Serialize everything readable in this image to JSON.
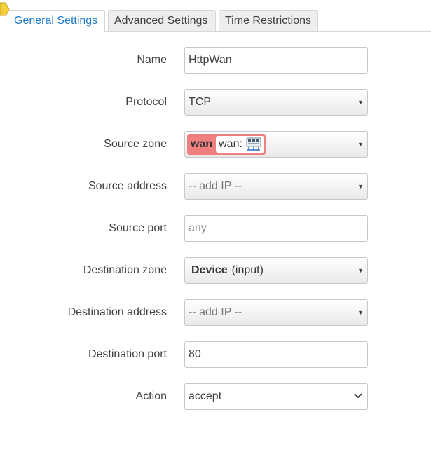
{
  "tabs": [
    {
      "label": "General Settings",
      "active": true
    },
    {
      "label": "Advanced Settings",
      "active": false
    },
    {
      "label": "Time Restrictions",
      "active": false
    }
  ],
  "form": {
    "name": {
      "label": "Name",
      "value": "HttpWan"
    },
    "protocol": {
      "label": "Protocol",
      "value": "TCP"
    },
    "source_zone": {
      "label": "Source zone",
      "zone": "wan",
      "network": "wan:",
      "icon": "network-ports-icon",
      "zone_color": "#f08080"
    },
    "source_address": {
      "label": "Source address",
      "placeholder": "-- add IP --"
    },
    "source_port": {
      "label": "Source port",
      "placeholder": "any"
    },
    "destination_zone": {
      "label": "Destination zone",
      "device": "Device",
      "detail": "(input)"
    },
    "destination_address": {
      "label": "Destination address",
      "placeholder": "-- add IP --"
    },
    "destination_port": {
      "label": "Destination port",
      "value": "80"
    },
    "action": {
      "label": "Action",
      "value": "accept"
    }
  },
  "colors": {
    "active_tab_text": "#1f79c5",
    "zone_wan": "#f08080",
    "corner_icon": "#f2c230"
  }
}
